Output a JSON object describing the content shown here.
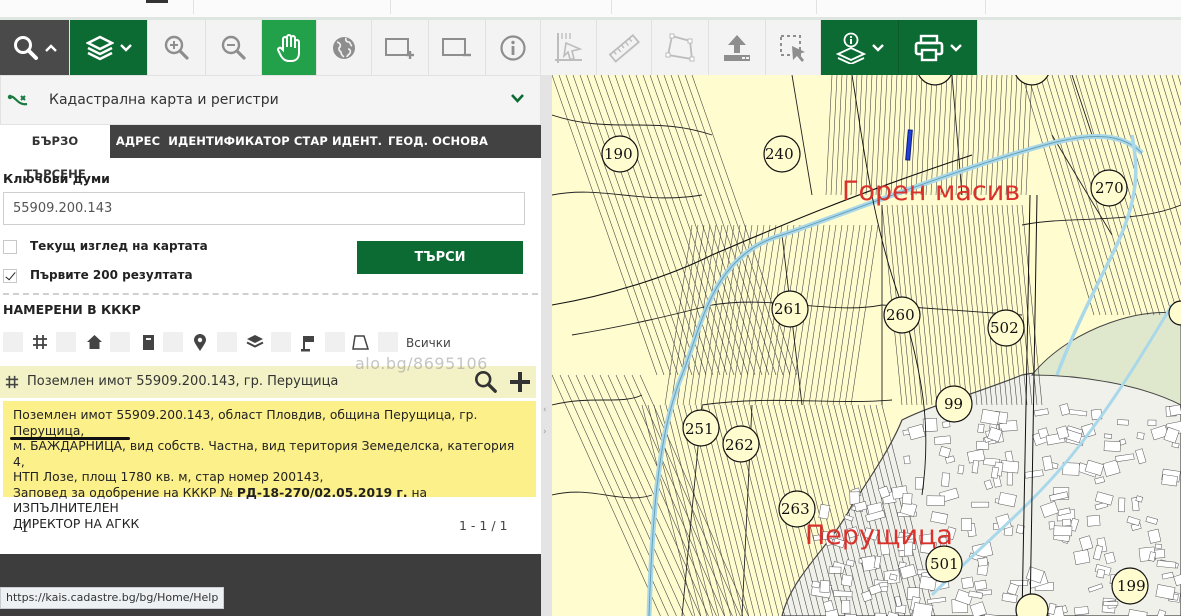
{
  "toolbar": {
    "buttons": [
      {
        "id": "search",
        "icon": "search-icon",
        "bg": "#4a4a4a"
      },
      {
        "id": "layers",
        "icon": "layers-icon",
        "bg": "#0b6b33"
      },
      {
        "id": "zoom-in",
        "icon": "zoom-in-icon"
      },
      {
        "id": "zoom-out",
        "icon": "zoom-out-icon"
      },
      {
        "id": "pan",
        "icon": "hand-icon",
        "bg": "#22a14a"
      },
      {
        "id": "full-extent",
        "icon": "globe-icon"
      },
      {
        "id": "zoom-box-in",
        "icon": "zoom-box-in-icon"
      },
      {
        "id": "zoom-box-out",
        "icon": "zoom-box-out-icon"
      },
      {
        "id": "info",
        "icon": "info-icon"
      },
      {
        "id": "coordinates",
        "icon": "coordinates-icon"
      },
      {
        "id": "measure-distance",
        "icon": "ruler-icon"
      },
      {
        "id": "measure-area",
        "icon": "polygon-icon"
      },
      {
        "id": "upload",
        "icon": "upload-icon"
      },
      {
        "id": "select",
        "icon": "select-icon"
      },
      {
        "id": "identify-layers",
        "icon": "info-layers-icon",
        "bg": "#0b6b33"
      },
      {
        "id": "print",
        "icon": "print-icon",
        "bg": "#0b6b33"
      }
    ]
  },
  "panel": {
    "layer_selector": "Кадастрална карта и регистри",
    "tabs": [
      {
        "label": "БЪРЗО ТЪРСЕНЕ",
        "active": true
      },
      {
        "label": "АДРЕС",
        "active": false
      },
      {
        "label": "ИДЕНТИФИКАТОР",
        "active": false
      },
      {
        "label": "СТАР ИДЕНТ.",
        "active": false
      },
      {
        "label": "ГЕОД. ОСНОВА",
        "active": false
      }
    ],
    "keywords_label": "Ключови думи",
    "keywords_value": "55909.200.143",
    "current_view_label": "Текущ изглед на картата",
    "current_view_checked": false,
    "first200_label": "Първите 200 резултата",
    "first200_checked": true,
    "search_button": "ТЪРСИ",
    "found_label": "НАМЕРЕНИ В КККР",
    "filters": {
      "icons": [
        "grid-icon",
        "house-icon",
        "building-icon",
        "pin-icon",
        "layers-icon",
        "flag-icon",
        "polygon-icon"
      ],
      "all_label": "Всички"
    },
    "watermark": "alo.bg/8695106",
    "result": {
      "title": "Поземлен имот 55909.200.143, гр. Перущица",
      "line1": "Поземлен имот 55909.200.143, област Пловдив, община Перущица, гр. Перущица,",
      "line2": "м. БАЖДАРНИЦА, вид собств. Частна, вид територия Земеделска, категория 4,",
      "line3": "НТП Лозе, площ 1780 кв. м, стар номер 200143,",
      "line4_prefix": "Заповед за одобрение на КККР № ",
      "line4_bold": "РД-18-270/02.05.2019 г.",
      "line4_suffix": " на ИЗПЪЛНИТЕЛЕН",
      "line5": "ДИРЕКТОР НА АГКК"
    },
    "page_number": "1",
    "page_range": "1 - 1 / 1"
  },
  "status_url": "https://kais.cadastre.bg/bg/Home/Help",
  "map": {
    "regions": [
      "Горен масив",
      "Перущица"
    ],
    "parcel_labels": [
      "190",
      "240",
      "270",
      "261",
      "260",
      "502",
      "99",
      "251",
      "262",
      "263",
      "501",
      "199"
    ]
  },
  "colors": {
    "toolbar_green": "#0b6b33",
    "toolbar_active": "#22a14a",
    "result_highlight": "#fcf08a",
    "map_background": "#fffccf",
    "region_label": "#d9312c"
  }
}
